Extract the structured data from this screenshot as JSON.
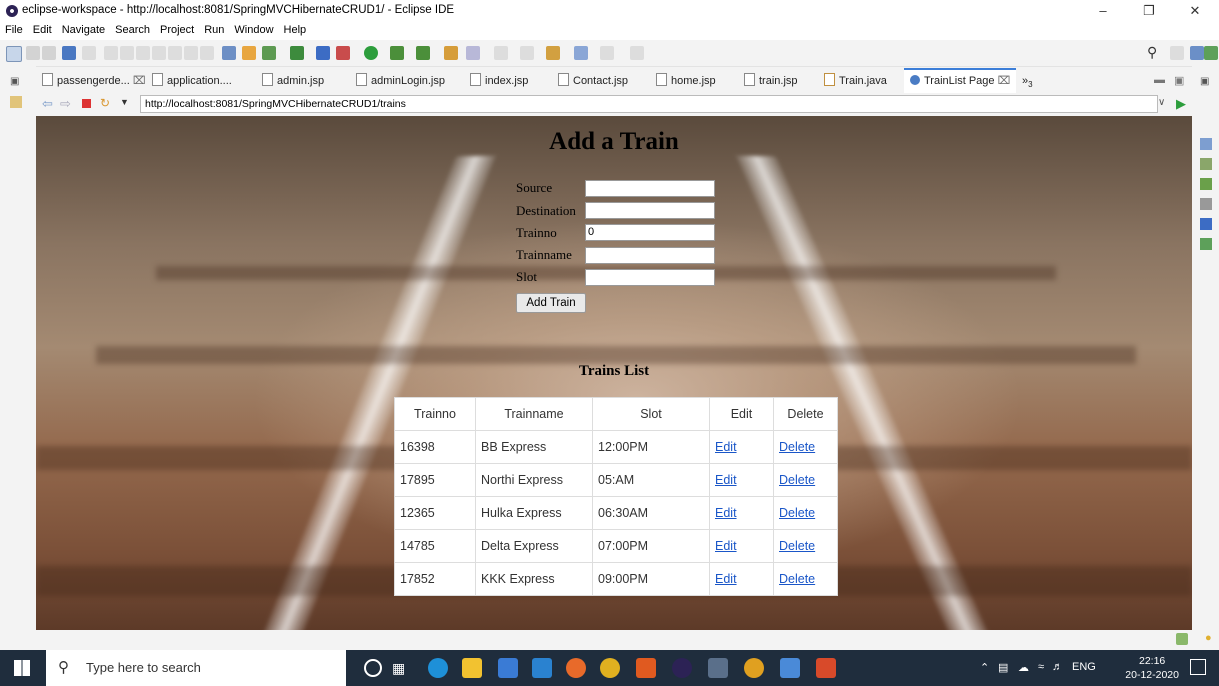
{
  "window": {
    "title": "eclipse-workspace - http://localhost:8081/SpringMVCHibernateCRUD1/ - Eclipse IDE"
  },
  "menu": [
    "File",
    "Edit",
    "Navigate",
    "Search",
    "Project",
    "Run",
    "Window",
    "Help"
  ],
  "tabs": [
    {
      "label": "passengerde...",
      "active": false
    },
    {
      "label": "application....",
      "active": false
    },
    {
      "label": "admin.jsp",
      "active": false
    },
    {
      "label": "adminLogin.jsp",
      "active": false
    },
    {
      "label": "index.jsp",
      "active": false
    },
    {
      "label": "Contact.jsp",
      "active": false
    },
    {
      "label": "home.jsp",
      "active": false
    },
    {
      "label": "train.jsp",
      "active": false
    },
    {
      "label": "Train.java",
      "active": false
    },
    {
      "label": "TrainList Page",
      "active": true
    }
  ],
  "tabs_overflow": "»",
  "tabs_overflow_count": "3",
  "browser": {
    "url": "http://localhost:8081/SpringMVCHibernateCRUD1/trains"
  },
  "page": {
    "heading": "Add a Train",
    "form": {
      "source_label": "Source",
      "source_value": "",
      "destination_label": "Destination",
      "destination_value": "",
      "trainno_label": "Trainno",
      "trainno_value": "0",
      "trainname_label": "Trainname",
      "trainname_value": "",
      "slot_label": "Slot",
      "slot_value": "",
      "submit_label": "Add Train"
    },
    "list_heading": "Trains List",
    "table": {
      "headers": [
        "Trainno",
        "Trainname",
        "Slot",
        "Edit",
        "Delete"
      ],
      "rows": [
        {
          "trainno": "16398",
          "trainname": "BB Express",
          "slot": "12:00PM",
          "edit": "Edit",
          "delete": "Delete"
        },
        {
          "trainno": "17895",
          "trainname": "Northi Express",
          "slot": "05:AM",
          "edit": "Edit",
          "delete": "Delete"
        },
        {
          "trainno": "12365",
          "trainname": "Hulka Express",
          "slot": "06:30AM",
          "edit": "Edit",
          "delete": "Delete"
        },
        {
          "trainno": "14785",
          "trainname": "Delta Express",
          "slot": "07:00PM",
          "edit": "Edit",
          "delete": "Delete"
        },
        {
          "trainno": "17852",
          "trainname": "KKK Express",
          "slot": "09:00PM",
          "edit": "Edit",
          "delete": "Delete"
        }
      ]
    }
  },
  "taskbar": {
    "search_placeholder": "Type here to search",
    "language": "ENG",
    "time": "22:16",
    "date": "20-12-2020"
  }
}
